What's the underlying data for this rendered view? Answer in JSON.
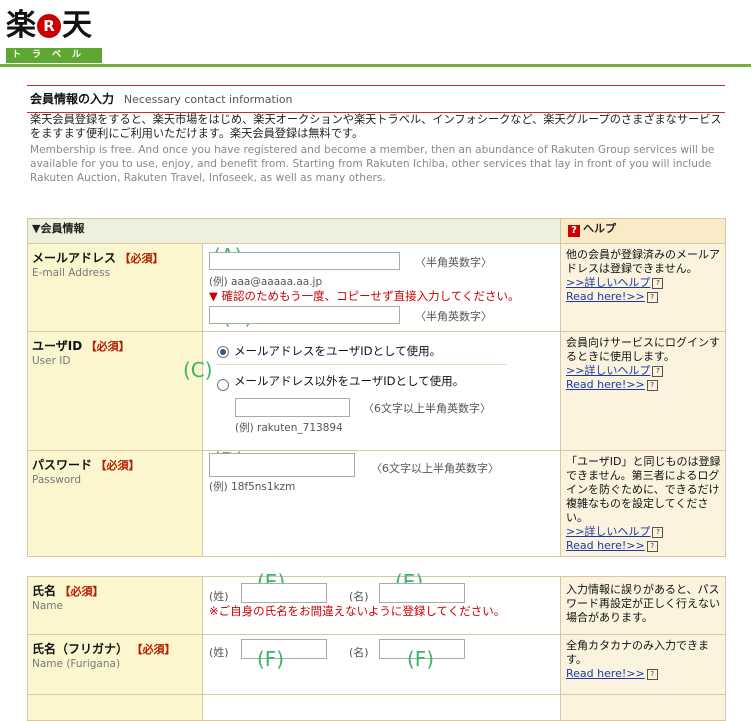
{
  "logo": {
    "kanji_left": "楽",
    "r_mark": "R",
    "kanji_right": "天",
    "sub": "トラベル"
  },
  "section": {
    "title_jp": "会員情報の入力",
    "title_en": "Necessary contact information"
  },
  "intro": {
    "jp": "楽天会員登録をすると、楽天市場をはじめ、楽天オークションや楽天トラベル、インフォシークなど、楽天グループのさまざまなサービスをますます便利にご利用いただけます。楽天会員登録は無料です。",
    "en": "Membership is free. And once you have registered and become a member, then an abundance of Rakuten Group services will be available for you to use, enjoy, and benefit from. Starting from Rakuten Ichiba, other services that lay in front of you will include Rakuten Auction, Rakuten Travel, Infoseek, as well as many others."
  },
  "table": {
    "header": "▼会員情報",
    "help_header": "ヘルプ",
    "help_icon": "question-icon",
    "required": "【必須】",
    "email": {
      "label_jp": "メールアドレス",
      "label_en": "E-mail Address",
      "marker_a": "(A)",
      "hint": "〈半角英数字〉",
      "example": "(例) aaa@aaaaa.aa.jp",
      "warning": "▼ 確認のためもう一度、コピーせず直接入力してください。",
      "marker_b": "(B)",
      "hint2": "〈半角英数字〉",
      "help": "他の会員が登録済みのメールアドレスは登録できません。",
      "help_link_jp": ">>詳しいヘルプ",
      "help_link_en": "Read here!>>"
    },
    "userid": {
      "label_jp": "ユーザID",
      "label_en": "User ID",
      "marker_c": "(C)",
      "option1": "メールアドレスをユーザIDとして使用。",
      "option2": "メールアドレス以外をユーザIDとして使用。",
      "hint": "〈6文字以上半角英数字〉",
      "example": "(例) rakuten_713894",
      "help": "会員向けサービスにログインするときに使用します。",
      "help_link_jp": ">>詳しいヘルプ",
      "help_link_en": "Read here!>>"
    },
    "password": {
      "label_jp": "パスワード",
      "label_en": "Password",
      "marker_d": "(D)",
      "hint": "〈6文字以上半角英数字〉",
      "example": "(例) 18f5ns1kzm",
      "help": "「ユーザID」と同じものは登録できません。第三者によるログインを防ぐために、できるだけ複雑なものを設定してください。",
      "help_link_jp": ">>詳しいヘルプ",
      "help_link_en": "Read here!>>"
    },
    "name": {
      "label_jp": "氏名",
      "label_en": "Name",
      "sei": "(姓)",
      "mei": "(名)",
      "marker_e": "(E)",
      "warning": "※ご自身の氏名をお間違えないように登録してください。",
      "help": "入力情報に誤りがあると、パスワード再設定が正しく行えない場合があります。"
    },
    "furigana": {
      "label_jp": "氏名（フリガナ）",
      "label_en": "Name (Furigana)",
      "sei": "(姓)",
      "mei": "(名)",
      "marker_f": "(F)",
      "help": "全角カタカナのみ入力できます。",
      "help_link_en": "Read here!>>"
    },
    "qmark": "?"
  }
}
